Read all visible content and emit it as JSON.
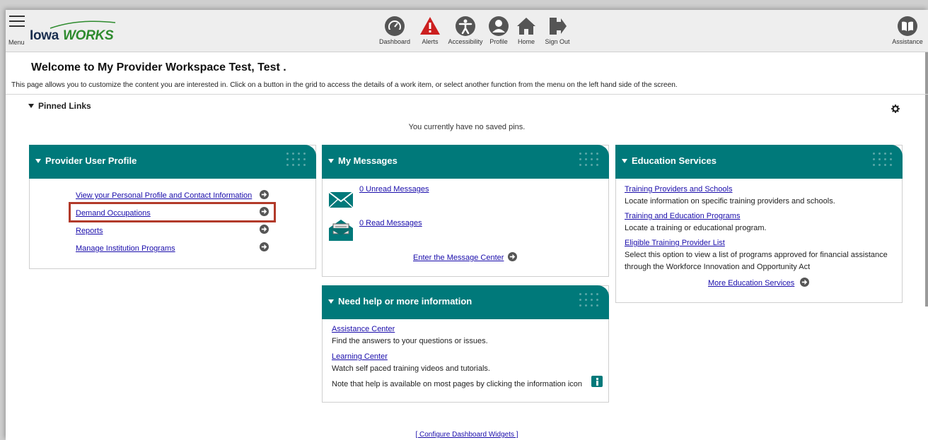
{
  "header": {
    "menu_label": "Menu",
    "logo_part1": "Iowa",
    "logo_part2": "WORKS",
    "nav": [
      {
        "label": "Dashboard",
        "icon": "dashboard-icon"
      },
      {
        "label": "Alerts",
        "icon": "alert-icon"
      },
      {
        "label": "Accessibility",
        "icon": "accessibility-icon"
      },
      {
        "label": "Profile",
        "icon": "profile-icon"
      },
      {
        "label": "Home",
        "icon": "home-icon"
      },
      {
        "label": "Sign Out",
        "icon": "sign-out-icon"
      }
    ],
    "assistance_label": "Assistance"
  },
  "welcome": {
    "title": "Welcome to My Provider Workspace Test, Test .",
    "intro": "This page allows you to customize the content you are interested in. Click on a button in the grid to access the details of a work item, or select another function from the menu on the left hand side of the screen."
  },
  "pinned": {
    "heading": "Pinned Links",
    "empty_text": "You currently have no saved pins."
  },
  "provider_profile": {
    "title": "Provider User Profile",
    "links": [
      "View your Personal Profile and Contact Information",
      "Demand Occupations",
      "Reports",
      "Manage Institution Programs"
    ]
  },
  "messages": {
    "title": "My Messages",
    "unread": "0 Unread Messages",
    "read": "0 Read Messages",
    "center_link": "Enter the Message Center"
  },
  "help": {
    "title": "Need help or more information",
    "assistance_link": "Assistance Center",
    "assistance_desc": "Find the answers to your questions or issues.",
    "learning_link": "Learning Center",
    "learning_desc": "Watch self paced training videos and tutorials.",
    "note": "Note that help is available on most pages by clicking the information icon"
  },
  "education": {
    "title": "Education Services",
    "items": [
      {
        "link": "Training Providers and Schools",
        "desc": "Locate information on specific training providers and schools."
      },
      {
        "link": "Training and Education Programs",
        "desc": "Locate a training or educational program."
      },
      {
        "link": "Eligible Training Provider List",
        "desc": "Select this option to view a list of programs approved for financial assistance",
        "desc2": "through the Workforce Innovation and Opportunity Act"
      }
    ],
    "more_link": "More Education Services"
  },
  "footer": {
    "configure_link": "[ Configure Dashboard Widgets ]"
  },
  "colors": {
    "widget_header": "#00797a",
    "link": "#1a0dab",
    "highlight_box": "#b23a2a",
    "alert_red": "#cc1f1f",
    "icon_gray": "#555555"
  }
}
